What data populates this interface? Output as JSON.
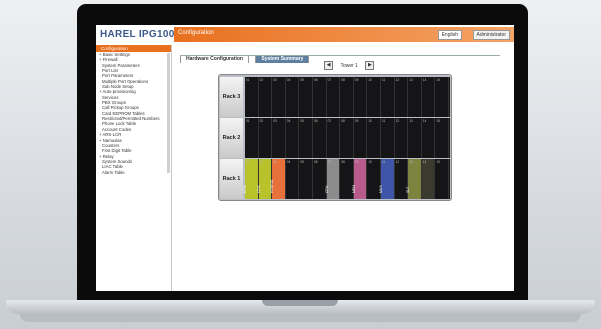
{
  "app": {
    "logo": "HAREL IPG1000",
    "title": "Configuration",
    "language": "English",
    "user": "Administrator"
  },
  "sidebar": {
    "header": "Configuration",
    "items": [
      {
        "label": "+ Basic Settings",
        "group": true
      },
      {
        "label": "+ Firewall",
        "group": true
      },
      {
        "label": "System Parameters",
        "group": false
      },
      {
        "label": "Port List",
        "group": false
      },
      {
        "label": "Port Parameters",
        "group": false
      },
      {
        "label": "Multiple Port Operations",
        "group": false
      },
      {
        "label": "Sub Node Setup",
        "group": false
      },
      {
        "label": "+ Auto-provisioning",
        "group": true
      },
      {
        "label": "Services",
        "group": false
      },
      {
        "label": "PBX Groups",
        "group": false
      },
      {
        "label": "Call Pickup Groups",
        "group": false
      },
      {
        "label": "Card EEPROM Tables",
        "group": false
      },
      {
        "label": "Restricted/Permitted Numbers",
        "group": false
      },
      {
        "label": "Phone Lock Table",
        "group": false
      },
      {
        "label": "Account Codes",
        "group": false
      },
      {
        "label": "+ ARS-LCR",
        "group": true
      },
      {
        "label": "+ Namuxlas",
        "group": true
      },
      {
        "label": "Counters",
        "group": false
      },
      {
        "label": "First Digit Table",
        "group": false
      },
      {
        "label": "+ Relay",
        "group": true
      },
      {
        "label": "System Sounds",
        "group": false
      },
      {
        "label": "LIAC Table",
        "group": false
      },
      {
        "label": "Alarm Table",
        "group": false
      }
    ]
  },
  "tabs": [
    {
      "label": "Hardware Configuration",
      "active": true
    },
    {
      "label": "System Summary",
      "active": false
    }
  ],
  "tower": {
    "label": "Tower 1",
    "prev": "◀",
    "next": "▶"
  },
  "racks": [
    {
      "label": "Rack 3",
      "slots": [
        "01",
        "02",
        "03",
        "04",
        "05",
        "06",
        "07",
        "08",
        "09",
        "10",
        "11",
        "12",
        "13",
        "14",
        "15"
      ]
    },
    {
      "label": "Rack 2",
      "slots": [
        "01",
        "02",
        "03",
        "04",
        "05",
        "06",
        "07",
        "08",
        "09",
        "10",
        "11",
        "12",
        "13",
        "14",
        "15"
      ]
    },
    {
      "label": "Rack 1",
      "slots": [
        "01",
        "02",
        "03",
        "04",
        "05",
        "06",
        "07",
        "08",
        "09",
        "10",
        "11",
        "12",
        "13",
        "14",
        "15"
      ]
    }
  ],
  "cards": [
    {
      "rack": 2,
      "slot": 0,
      "text": "DTIC",
      "color": "#b8c22a"
    },
    {
      "rack": 2,
      "slot": 1,
      "text": "DTIC",
      "color": "#b8c22a"
    },
    {
      "rack": 2,
      "slot": 2,
      "text": "HYBRID",
      "color": "#e8703a"
    },
    {
      "rack": 2,
      "slot": 6,
      "text": "CPU",
      "color": "#8c8c8c"
    },
    {
      "rack": 2,
      "slot": 8,
      "text": "MEM",
      "color": "#b95a8c"
    },
    {
      "rack": 2,
      "slot": 10,
      "text": "MUX",
      "color": "#3f55a8"
    },
    {
      "rack": 2,
      "slot": 12,
      "text": "SLT",
      "color": "#7c8440"
    },
    {
      "rack": 2,
      "slot": 13,
      "text": "",
      "color": "#3a3a2e"
    }
  ]
}
